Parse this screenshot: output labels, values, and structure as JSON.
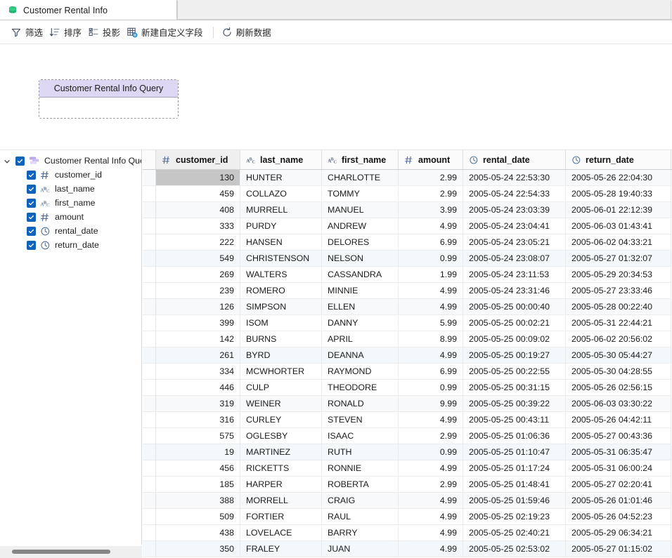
{
  "window": {
    "tab": {
      "title": "Customer Rental Info",
      "icon": "database-icon"
    }
  },
  "toolbar": {
    "buttons": [
      {
        "label": "筛选",
        "icon": "filter-icon"
      },
      {
        "label": "排序",
        "icon": "sort-icon"
      },
      {
        "label": "投影",
        "icon": "projection-icon"
      },
      {
        "label": "新建自定义字段",
        "icon": "new-custom-field-icon"
      },
      {
        "label": "刷新数据",
        "icon": "refresh-icon"
      }
    ]
  },
  "canvas": {
    "node": {
      "title": "Customer Rental Info Query"
    }
  },
  "sidebar": {
    "root": {
      "label": "Customer Rental Info Quer",
      "checked": true,
      "expanded": true,
      "icon": "query-node-icon"
    },
    "items": [
      {
        "label": "customer_id",
        "type_icon": "number-icon",
        "checked": true
      },
      {
        "label": "last_name",
        "type_icon": "text-icon",
        "checked": true
      },
      {
        "label": "first_name",
        "type_icon": "text-icon",
        "checked": true
      },
      {
        "label": "amount",
        "type_icon": "number-icon",
        "checked": true
      },
      {
        "label": "rental_date",
        "type_icon": "datetime-icon",
        "checked": true
      },
      {
        "label": "return_date",
        "type_icon": "datetime-icon",
        "checked": true
      }
    ]
  },
  "grid": {
    "columns": [
      {
        "label": "customer_id",
        "type_icon": "number-icon",
        "align": "right",
        "active": true
      },
      {
        "label": "last_name",
        "type_icon": "text-icon",
        "align": "left",
        "active": false
      },
      {
        "label": "first_name",
        "type_icon": "text-icon",
        "align": "left",
        "active": false
      },
      {
        "label": "amount",
        "type_icon": "number-icon",
        "align": "right",
        "active": false
      },
      {
        "label": "rental_date",
        "type_icon": "datetime-icon",
        "align": "left",
        "active": false
      },
      {
        "label": "return_date",
        "type_icon": "datetime-icon",
        "align": "left",
        "active": false
      }
    ],
    "rows": [
      {
        "cells": [
          "130",
          "HUNTER",
          "CHARLOTTE",
          "2.99",
          "2005-05-24 22:53:30",
          "2005-05-26 22:04:30"
        ],
        "state": "even",
        "selected_cell": 0
      },
      {
        "cells": [
          "459",
          "COLLAZO",
          "TOMMY",
          "2.99",
          "2005-05-24 22:54:33",
          "2005-05-28 19:40:33"
        ],
        "state": "odd"
      },
      {
        "cells": [
          "408",
          "MURRELL",
          "MANUEL",
          "3.99",
          "2005-05-24 23:03:39",
          "2005-06-01 22:12:39"
        ],
        "state": "even"
      },
      {
        "cells": [
          "333",
          "PURDY",
          "ANDREW",
          "4.99",
          "2005-05-24 23:04:41",
          "2005-06-03 01:43:41"
        ],
        "state": "odd"
      },
      {
        "cells": [
          "222",
          "HANSEN",
          "DELORES",
          "6.99",
          "2005-05-24 23:05:21",
          "2005-06-02 04:33:21"
        ],
        "state": "odd"
      },
      {
        "cells": [
          "549",
          "CHRISTENSON",
          "NELSON",
          "0.99",
          "2005-05-24 23:08:07",
          "2005-05-27 01:32:07"
        ],
        "state": "hl"
      },
      {
        "cells": [
          "269",
          "WALTERS",
          "CASSANDRA",
          "1.99",
          "2005-05-24 23:11:53",
          "2005-05-29 20:34:53"
        ],
        "state": "odd"
      },
      {
        "cells": [
          "239",
          "ROMERO",
          "MINNIE",
          "4.99",
          "2005-05-24 23:31:46",
          "2005-05-27 23:33:46"
        ],
        "state": "odd"
      },
      {
        "cells": [
          "126",
          "SIMPSON",
          "ELLEN",
          "4.99",
          "2005-05-25 00:00:40",
          "2005-05-28 00:22:40"
        ],
        "state": "even"
      },
      {
        "cells": [
          "399",
          "ISOM",
          "DANNY",
          "5.99",
          "2005-05-25 00:02:21",
          "2005-05-31 22:44:21"
        ],
        "state": "odd"
      },
      {
        "cells": [
          "142",
          "BURNS",
          "APRIL",
          "8.99",
          "2005-05-25 00:09:02",
          "2005-06-02 20:56:02"
        ],
        "state": "odd"
      },
      {
        "cells": [
          "261",
          "BYRD",
          "DEANNA",
          "4.99",
          "2005-05-25 00:19:27",
          "2005-05-30 05:44:27"
        ],
        "state": "hl"
      },
      {
        "cells": [
          "334",
          "MCWHORTER",
          "RAYMOND",
          "6.99",
          "2005-05-25 00:22:55",
          "2005-05-30 04:28:55"
        ],
        "state": "odd"
      },
      {
        "cells": [
          "446",
          "CULP",
          "THEODORE",
          "0.99",
          "2005-05-25 00:31:15",
          "2005-05-26 02:56:15"
        ],
        "state": "odd"
      },
      {
        "cells": [
          "319",
          "WEINER",
          "RONALD",
          "9.99",
          "2005-05-25 00:39:22",
          "2005-06-03 03:30:22"
        ],
        "state": "even"
      },
      {
        "cells": [
          "316",
          "CURLEY",
          "STEVEN",
          "4.99",
          "2005-05-25 00:43:11",
          "2005-05-26 04:42:11"
        ],
        "state": "odd"
      },
      {
        "cells": [
          "575",
          "OGLESBY",
          "ISAAC",
          "2.99",
          "2005-05-25 01:06:36",
          "2005-05-27 00:43:36"
        ],
        "state": "odd"
      },
      {
        "cells": [
          "19",
          "MARTINEZ",
          "RUTH",
          "0.99",
          "2005-05-25 01:10:47",
          "2005-05-31 06:35:47"
        ],
        "state": "hl"
      },
      {
        "cells": [
          "456",
          "RICKETTS",
          "RONNIE",
          "4.99",
          "2005-05-25 01:17:24",
          "2005-05-31 06:00:24"
        ],
        "state": "odd"
      },
      {
        "cells": [
          "185",
          "HARPER",
          "ROBERTA",
          "2.99",
          "2005-05-25 01:48:41",
          "2005-05-27 02:20:41"
        ],
        "state": "odd"
      },
      {
        "cells": [
          "388",
          "MORRELL",
          "CRAIG",
          "4.99",
          "2005-05-25 01:59:46",
          "2005-05-26 01:01:46"
        ],
        "state": "even"
      },
      {
        "cells": [
          "509",
          "FORTIER",
          "RAUL",
          "4.99",
          "2005-05-25 02:19:23",
          "2005-05-26 04:52:23"
        ],
        "state": "odd"
      },
      {
        "cells": [
          "438",
          "LOVELACE",
          "BARRY",
          "4.99",
          "2005-05-25 02:40:21",
          "2005-05-29 06:34:21"
        ],
        "state": "odd"
      },
      {
        "cells": [
          "350",
          "FRALEY",
          "JUAN",
          "4.99",
          "2005-05-25 02:53:02",
          "2005-05-27 01:15:02"
        ],
        "state": "hl"
      }
    ]
  },
  "colors": {
    "accent": "#1063ba",
    "node_header": "#ded7f3",
    "selected_cell": "#c6c6c6",
    "highlight_row": "#f3f8fd"
  }
}
